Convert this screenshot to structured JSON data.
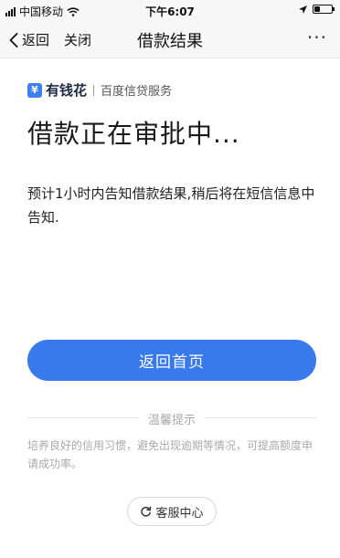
{
  "status_bar": {
    "carrier": "中国移动",
    "time": "下午6:07"
  },
  "nav": {
    "back_label": "返回",
    "close_label": "关闭",
    "title": "借款结果",
    "more_label": "···"
  },
  "brand": {
    "logo_text": "¥",
    "name": "有钱花",
    "subtitle": "百度信贷服务"
  },
  "main": {
    "headline": "借款正在审批中...",
    "description": "预计1小时内告知借款结果,稍后将在短信信息中告知."
  },
  "primary_button": {
    "label": "返回首页"
  },
  "tips": {
    "title": "温馨提示",
    "text": "培养良好的信用习惯，避免出现逾期等情况，可提高额度申请成功率。"
  },
  "service_button": {
    "label": "客服中心"
  },
  "colors": {
    "accent": "#3879ec",
    "nav_background": "#f7f7f7",
    "muted_text": "#aaaaaa"
  }
}
